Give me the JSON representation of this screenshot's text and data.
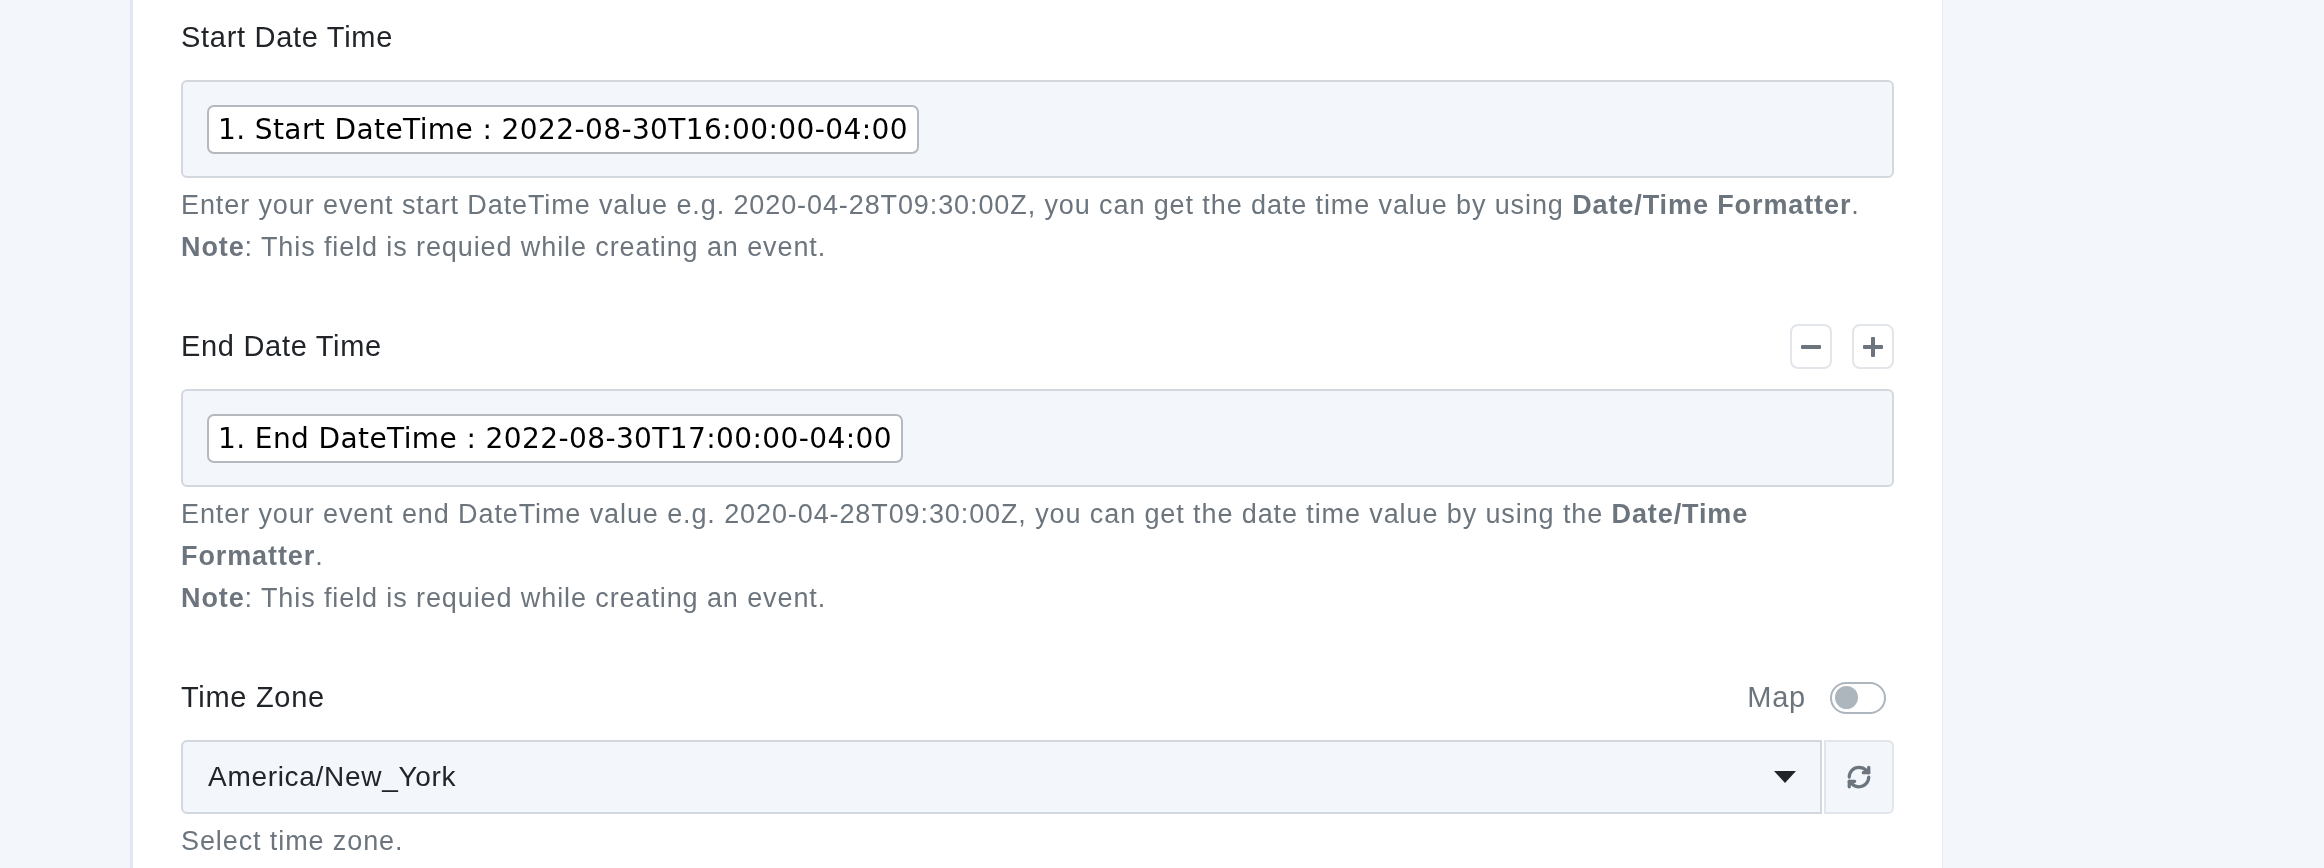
{
  "fields": [
    {
      "kind": "token",
      "label": "Start Date Time",
      "tokens": [
        "1. Start DateTime : 2022-08-30T16:00:00-04:00"
      ],
      "help": [
        "Enter your event start DateTime value e.g. 2020-04-28T09:30:00Z, you can get the date time value by using **Date/Time Formatter**.",
        "**Note**: This field is requied while creating an event."
      ]
    },
    {
      "kind": "token",
      "label": "End Date Time",
      "buttons": [
        {
          "kind": "remove"
        },
        {
          "kind": "add"
        }
      ],
      "tokens": [
        "1. End DateTime : 2022-08-30T17:00:00-04:00"
      ],
      "help": [
        "Enter your event end DateTime value e.g. 2020-04-28T09:30:00Z, you can get the date time value by using the **Date/Time Formatter**.",
        "**Note**: This field is requied while creating an event."
      ]
    },
    {
      "kind": "select",
      "label": "Time Zone",
      "toggle": {
        "label": "Map",
        "on": false
      },
      "value": "America/New_York",
      "side_buttons": [
        {
          "kind": "refresh"
        }
      ],
      "help": [
        "Select time zone."
      ]
    }
  ]
}
